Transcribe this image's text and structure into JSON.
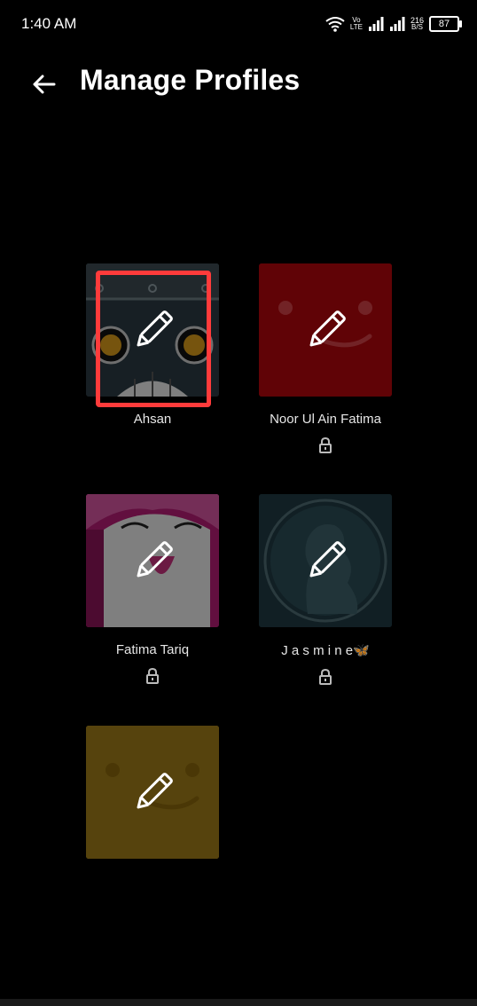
{
  "status_bar": {
    "time": "1:40 AM",
    "network_line1": "Vo",
    "network_line2": "LTE",
    "speed_value": "216",
    "speed_unit": "B/S",
    "battery": "87"
  },
  "header": {
    "title": "Manage Profiles"
  },
  "profiles": [
    {
      "name": "Ahsan",
      "locked": false,
      "avatar_icon": "robot-face-avatar"
    },
    {
      "name": "Noor Ul Ain Fatima",
      "locked": true,
      "avatar_icon": "red-smile-avatar"
    },
    {
      "name": "Fatima Tariq",
      "locked": true,
      "avatar_icon": "pink-character-avatar"
    },
    {
      "name": "J a s m i n e🦋",
      "locked": true,
      "avatar_icon": "cameo-portrait-avatar"
    },
    {
      "name": "",
      "locked": false,
      "avatar_icon": "yellow-smile-avatar"
    }
  ],
  "colors": {
    "background": "#000000",
    "highlight": "#ff3b3b",
    "red_avatar": "#b0060c",
    "yellow_avatar": "#d8a821",
    "pink_avatar": "#b31d74",
    "teal_avatar": "#1f3a42"
  }
}
